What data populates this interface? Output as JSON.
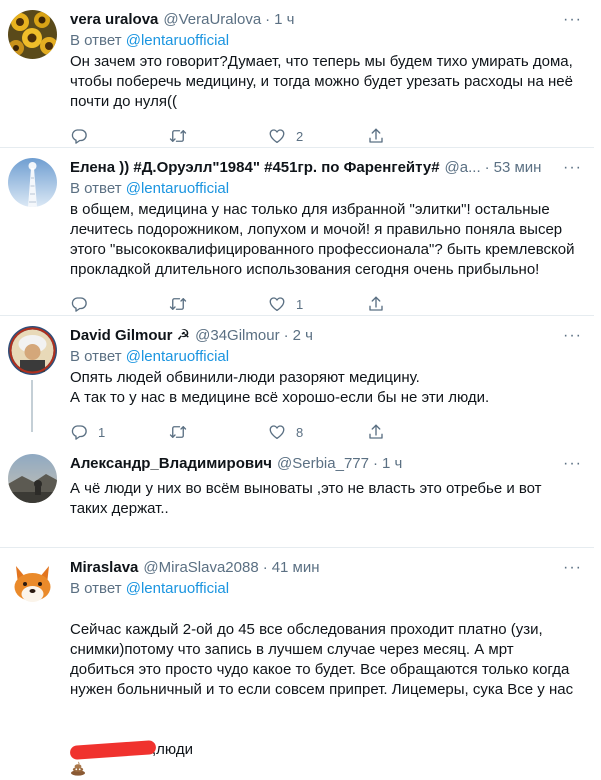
{
  "tweets": [
    {
      "name": "vera uralova",
      "handle": "@VeraUralova",
      "dot": "·",
      "time": "1 ч",
      "reply_prefix": "В ответ",
      "reply_to": "@lentaruofficial",
      "text": "Он зачем это говорит?Думает, что теперь мы будем тихо умирать дома, чтобы поберечь медицину, и тогда можно будет урезать расходы на неё почти до нуля((",
      "replies": "",
      "retweets": "",
      "likes": "2"
    },
    {
      "name": "Елена )) #Д.Оруэлл\"1984\" #451гр. по Фаренгейту#",
      "handle": "@a...",
      "dot": "·",
      "time": "53 мин",
      "reply_prefix": "В ответ",
      "reply_to": "@lentaruofficial",
      "text": "в общем, медицина у нас только для избранной \"элитки\"! остальные лечитесь подорожником, лопухом и мочой! я правильно поняла высер этого \"высококвалифицированного профессионала\"? быть кремлевской прокладкой длительного использования сегодня очень прибыльно!",
      "replies": "",
      "retweets": "",
      "likes": "1"
    },
    {
      "name": "David Gilmour ☭",
      "handle": "@34Gilmour",
      "dot": "·",
      "time": "2 ч",
      "reply_prefix": "В ответ",
      "reply_to": "@lentaruofficial",
      "text": "Опять людей обвинили-люди разоряют медицину.\nА так то у нас в медицине всё хорошо-если бы не эти люди.",
      "replies": "1",
      "retweets": "",
      "likes": "8"
    },
    {
      "name": "Александр_Владимирович",
      "handle": "@Serbia_777",
      "dot": "·",
      "time": "1 ч",
      "text": "А чё люди у них во всём выноваты ,это не власть это отребье и вот таких держат..",
      "replies": "",
      "retweets": "",
      "likes": ""
    },
    {
      "name": "Miraslava",
      "handle": "@MiraSlava2088",
      "dot": "·",
      "time": "41 мин",
      "reply_prefix": "В ответ",
      "reply_to": "@lentaruofficial",
      "text": "Сейчас каждый 2-ой до 45 все обследования проходит платно (узи, снимки)потому что запись в лучшем случае через месяц. А мрт добиться это просто чудо какое то будет. Все обращаются только когда нужен больничный и то если совсем припрет. Лицемеры, сука Все у нас",
      "text_tail": ",люди",
      "replies": "",
      "retweets": "",
      "likes": ""
    }
  ],
  "more_label": "···",
  "icons": {
    "reply": "reply-icon",
    "retweet": "retweet-icon",
    "like": "heart-icon",
    "share": "share-icon",
    "redaction": "red-scribble",
    "emoji": "pile-of-poo-emoji"
  },
  "colors": {
    "link": "#1b95e0",
    "secondary": "#5b7083",
    "divider": "#e6ecf0"
  }
}
